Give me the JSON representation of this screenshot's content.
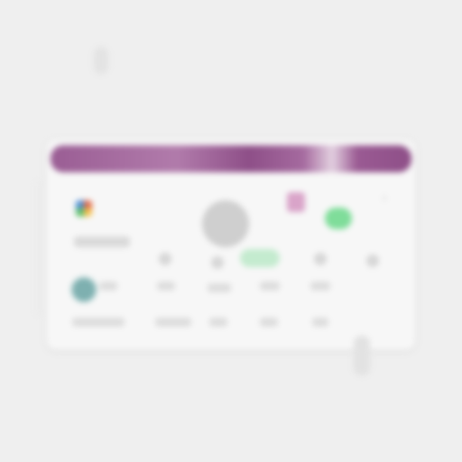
{
  "window": {
    "title": "",
    "logo_text": ""
  },
  "icons": {
    "corner": "›"
  },
  "colors": {
    "titlebar": "#9a5d94",
    "accent_pink": "#d9a4c9",
    "accent_green": "#7fdd9a",
    "avatar_teal": "#7eb0b0"
  }
}
